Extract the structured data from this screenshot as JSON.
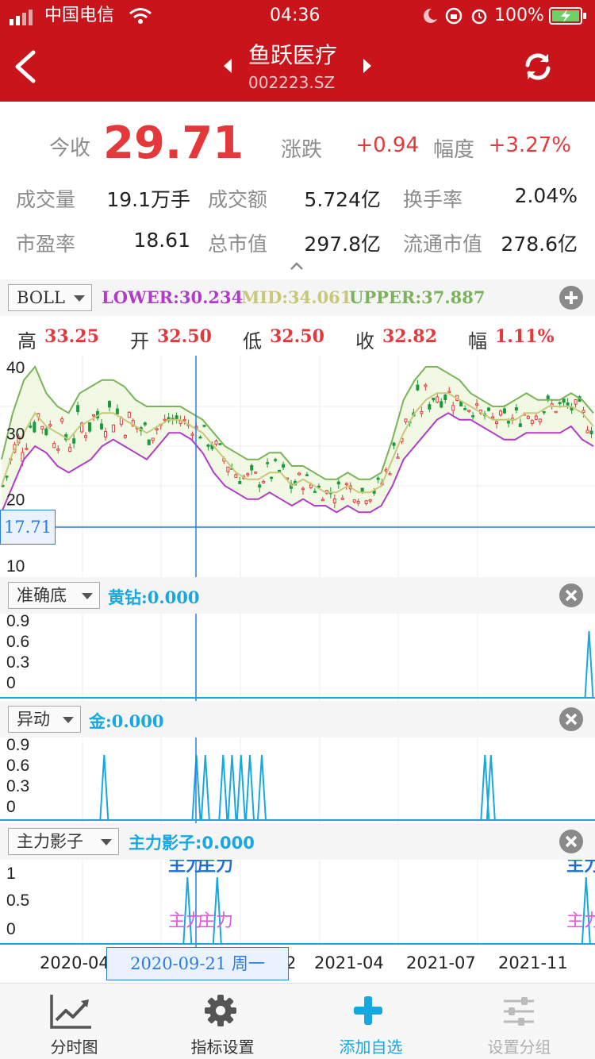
{
  "status": {
    "carrier": "中国电信",
    "time": "04:36",
    "battery": "100%"
  },
  "nav": {
    "stock_name": "鱼跃医疗",
    "stock_code": "002223.SZ"
  },
  "quote": {
    "close_label": "今收",
    "close": "29.71",
    "change_label": "涨跌",
    "change": "+0.94",
    "range_label": "幅度",
    "range": "+3.27%",
    "volume_label": "成交量",
    "volume": "19.1万手",
    "amount_label": "成交额",
    "amount": "5.724亿",
    "turnover_label": "换手率",
    "turnover": "2.04%",
    "pe_label": "市盈率",
    "pe": "18.61",
    "mcap_label": "总市值",
    "mcap": "297.8亿",
    "float_label": "流通市值",
    "float_cap": "278.6亿"
  },
  "boll": {
    "selector": "BOLL",
    "lower": "LOWER:30.234",
    "mid": "MID:34.061",
    "upper": "UPPER:37.887"
  },
  "ohlc": {
    "high_label": "高",
    "high": "33.25",
    "open_label": "开",
    "open": "32.50",
    "low_label": "低",
    "low": "32.50",
    "close_label": "收",
    "close": "32.82",
    "amp_label": "幅",
    "amp": "1.11%"
  },
  "cursor": {
    "price": "17.71",
    "date": "2020-09-21 周一"
  },
  "panels": {
    "p1": {
      "selector": "准确底",
      "label": "黄钻:0.000"
    },
    "p2": {
      "selector": "异动",
      "label": "金:0.000"
    },
    "p3": {
      "selector": "主力影子",
      "label": "主力影子:0.000",
      "marker": "主力"
    }
  },
  "axis": {
    "main": [
      "40",
      "30",
      "20",
      "10"
    ],
    "p1": [
      "0.9",
      "0.6",
      "0.3",
      "0"
    ],
    "p2": [
      "0.9",
      "0.6",
      "0.3",
      "0"
    ],
    "p3": [
      "1",
      "0.5",
      "0"
    ],
    "x": [
      "2020-04",
      "2",
      "2021-04",
      "2021-07",
      "2021-11"
    ]
  },
  "tabs": [
    {
      "label": "分时图",
      "icon": "line-chart-icon"
    },
    {
      "label": "指标设置",
      "icon": "gear-icon"
    },
    {
      "label": "添加自选",
      "icon": "plus-icon"
    },
    {
      "label": "设置分组",
      "icon": "sliders-icon"
    }
  ],
  "colors": {
    "header": "#c8141a",
    "up": "#e5383b",
    "down": "#1a9a3c",
    "lower": "#b13cc8",
    "mid": "#c8c878",
    "upper": "#7ab35a",
    "cyan": "#18a7e0",
    "magenta": "#e35ad8",
    "cursor": "#2a7be3"
  },
  "chart_data": [
    {
      "type": "candlestick",
      "title": "",
      "ylim": [
        10,
        40
      ],
      "yticks": [
        40,
        30,
        20,
        10
      ],
      "x_ticks": [
        "2020-04",
        "2",
        "2021-04",
        "2021-07",
        "2021-11"
      ],
      "series": [
        {
          "name": "LOWER",
          "values": [
            18,
            22,
            26,
            28,
            27,
            25,
            24,
            25,
            26,
            28,
            29,
            28,
            27,
            26,
            28,
            30,
            30,
            29,
            27,
            24,
            22,
            21,
            20,
            20,
            21,
            20,
            19,
            20,
            19,
            19,
            18,
            19,
            18,
            18,
            19,
            22,
            26,
            28,
            30,
            32,
            33,
            32,
            32,
            31,
            30,
            29,
            29,
            30,
            30,
            30,
            30,
            31,
            29,
            28
          ]
        },
        {
          "name": "MID",
          "values": [
            22,
            27,
            30,
            33,
            31,
            30,
            29,
            31,
            32,
            33,
            33,
            32,
            31,
            30,
            31,
            32,
            32,
            31,
            30,
            28,
            26,
            24,
            23,
            23,
            24,
            24,
            22,
            23,
            22,
            21,
            21,
            22,
            21,
            21,
            22,
            26,
            30,
            33,
            35,
            36,
            36,
            35,
            34,
            33,
            32,
            32,
            32,
            33,
            33,
            34,
            34,
            34,
            33,
            31
          ]
        },
        {
          "name": "UPPER",
          "values": [
            26,
            33,
            38,
            40,
            36,
            34,
            33,
            36,
            37,
            38,
            38,
            37,
            35,
            34,
            34,
            34,
            34,
            33,
            32,
            30,
            28,
            27,
            26,
            26,
            27,
            27,
            25,
            25,
            24,
            23,
            23,
            24,
            23,
            23,
            24,
            29,
            35,
            38,
            40,
            40,
            39,
            38,
            36,
            35,
            34,
            34,
            35,
            36,
            35,
            35,
            35,
            36,
            35,
            33
          ]
        }
      ]
    },
    {
      "type": "line",
      "name": "黄钻",
      "ylim": [
        0,
        0.9
      ],
      "spikes_at": [
        0.99
      ],
      "value": 0.0
    },
    {
      "type": "line",
      "name": "金",
      "ylim": [
        0,
        0.9
      ],
      "spikes_at": [
        0.175,
        0.33,
        0.345,
        0.375,
        0.39,
        0.405,
        0.42,
        0.44,
        0.815,
        0.825
      ],
      "value": 0.0
    },
    {
      "type": "line",
      "name": "主力影子",
      "ylim": [
        0,
        1
      ],
      "spikes_at": [
        0.315,
        0.365,
        0.985
      ],
      "value": 0.0
    }
  ]
}
